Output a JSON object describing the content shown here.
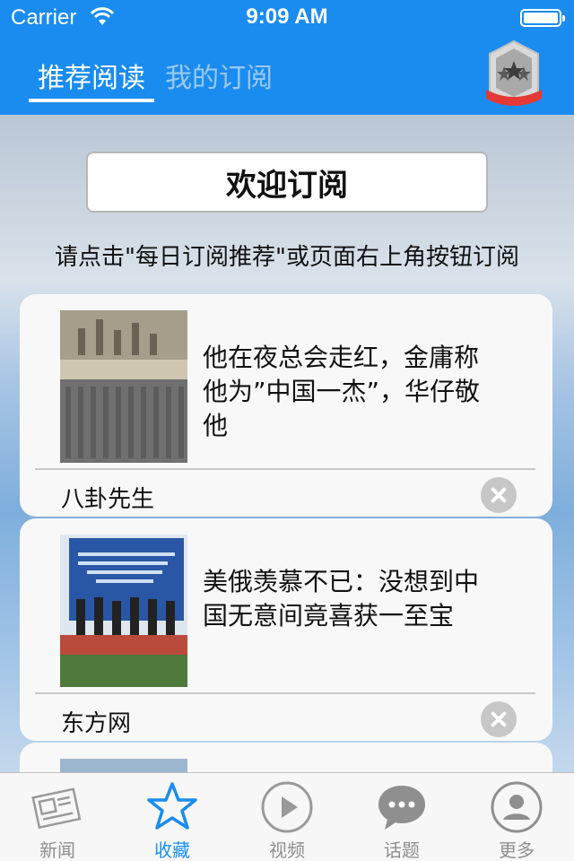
{
  "status_bar": {
    "carrier": "Carrier",
    "time": "9:09 AM"
  },
  "header": {
    "tabs": [
      {
        "label": "推荐阅读",
        "active": true
      },
      {
        "label": "我的订阅",
        "active": false
      }
    ],
    "medal_icon": "medal-stars-icon"
  },
  "welcome": {
    "button_label": "欢迎订阅",
    "hint": "请点击\"每日订阅推荐\"或页面右上角按钮订阅"
  },
  "cards": [
    {
      "title": "他在夜总会走红，金庸称他为”中国一杰”，华仔敬他",
      "source": "八卦先生"
    },
    {
      "title": "美俄羡慕不已：没想到中国无意间竟喜获一至宝",
      "source": "东方网"
    }
  ],
  "tabbar": {
    "items": [
      {
        "label": "新闻",
        "icon": "newspaper-icon"
      },
      {
        "label": "收藏",
        "icon": "star-icon",
        "active": true
      },
      {
        "label": "视频",
        "icon": "play-icon"
      },
      {
        "label": "话题",
        "icon": "chat-bubble-icon"
      },
      {
        "label": "更多",
        "icon": "user-icon"
      }
    ]
  },
  "colors": {
    "accent": "#1a8cf0",
    "inactive": "#8e8e8e"
  }
}
